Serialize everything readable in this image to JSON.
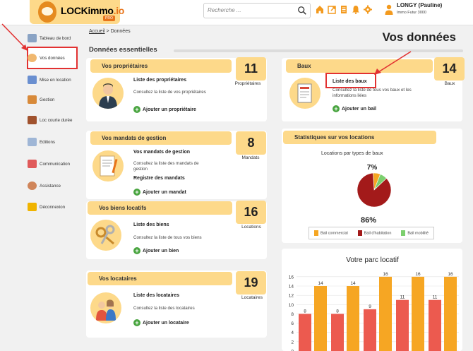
{
  "header": {
    "logo_text_1": "LOCKimmo",
    "logo_text_2": ".io",
    "logo_badge": "PRO",
    "search_placeholder": "Recherche ...",
    "user_name": "LONGY (Pauline)",
    "user_company": "Immo Futur 3000",
    "icons": [
      "home-icon",
      "external-link-icon",
      "document-icon",
      "bell-icon",
      "gear-icon",
      "user-icon"
    ]
  },
  "sidebar": {
    "items": [
      {
        "label": "Tableau de bord",
        "icon": "dashboard-icon",
        "color": "#8aa3c4"
      },
      {
        "label": "Vos données",
        "icon": "person-icon",
        "color": "#f0b870"
      },
      {
        "label": "Mise en location",
        "icon": "house-key-icon",
        "color": "#6a8fd0"
      },
      {
        "label": "Gestion",
        "icon": "gestion-icon",
        "color": "#d88a3a"
      },
      {
        "label": "Loc courte durée",
        "icon": "suitcase-icon",
        "color": "#a0522d"
      },
      {
        "label": "Editions",
        "icon": "editions-icon",
        "color": "#9fb6d6"
      },
      {
        "label": "Communication",
        "icon": "chat-icon",
        "color": "#e05a5a"
      },
      {
        "label": "Assistance",
        "icon": "assistance-icon",
        "color": "#d0855a"
      },
      {
        "label": "Déconnexion",
        "icon": "logout-icon",
        "color": "#f0b400"
      }
    ]
  },
  "breadcrumb": {
    "home": "Accueil",
    "sep": " > ",
    "current": "Données"
  },
  "page_title": "Vos données",
  "section_title": "Données essentielles",
  "cards": {
    "proprietaires": {
      "title": "Vos propriétaires",
      "count": "11",
      "count_label": "Propriétaires",
      "link": "Liste des propriétaires",
      "desc": "Consultez la liste de vos propriétaires",
      "add": "Ajouter un propriétaire"
    },
    "mandats": {
      "title": "Vos mandats de gestion",
      "count": "8",
      "count_label": "Mandats",
      "link": "Vos mandats de gestion",
      "desc": "Consultez la liste des mandats de gestion",
      "link2": "Registre des mandats",
      "add": "Ajouter un mandat"
    },
    "biens": {
      "title": "Vos biens locatifs",
      "count": "16",
      "count_label": "Locations",
      "link": "Liste des biens",
      "desc": "Consultez la liste de tous vos biens",
      "add": "Ajouter un bien"
    },
    "locataires": {
      "title": "Vos locataires",
      "count": "19",
      "count_label": "Locataires",
      "link": "Liste des locataires",
      "desc": "Consultez la liste des locataires",
      "add": "Ajouter un locataire"
    },
    "baux": {
      "title": "Baux",
      "count": "14",
      "count_label": "Baux",
      "link": "Liste des baux",
      "desc": "Consultez la liste de tous vos baux et les informations liées",
      "add": "Ajouter un bail"
    }
  },
  "stats": {
    "title": "Statistiques sur vos locations"
  },
  "chart_data": [
    {
      "type": "pie",
      "title": "Locations par types de baux",
      "categories": [
        "Bail commercial",
        "Bail d'habitation",
        "Bail mobilité"
      ],
      "values": [
        7,
        86,
        7
      ],
      "labels_shown": [
        "7%",
        "86%"
      ],
      "colors": [
        "#f5a623",
        "#a31a1a",
        "#7ccf6e"
      ],
      "legend_position": "bottom"
    },
    {
      "type": "bar",
      "title": "Votre parc locatif",
      "series": [
        {
          "values": [
            8,
            8,
            9,
            11,
            11
          ],
          "color": "#ec5a4f"
        },
        {
          "values": [
            14,
            14,
            16,
            16,
            16
          ],
          "color": "#f6a623"
        }
      ],
      "y_ticks": [
        0,
        2,
        4,
        6,
        8,
        10,
        12,
        14,
        16
      ],
      "ylim": [
        0,
        17.5
      ],
      "grid": true
    }
  ]
}
